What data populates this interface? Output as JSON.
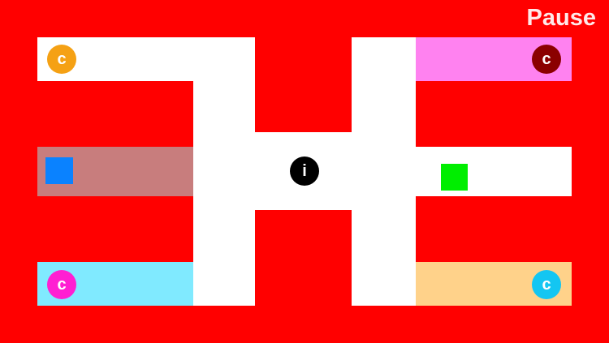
{
  "hud": {
    "pause_label": "Pause"
  },
  "colors": {
    "background": "#ff0000",
    "path": "#ffffff",
    "pink_zone": "#ff82f0",
    "gray_zone": "#c87d7d",
    "cyan_zone": "#80eaff",
    "orange_zone": "#ffd28a",
    "player": "#0a82ff",
    "goal": "#00ee00"
  },
  "coins": [
    {
      "name": "coin-top-left",
      "label": "c",
      "color": "#f5a114"
    },
    {
      "name": "coin-top-right",
      "label": "c",
      "color": "#8b0000"
    },
    {
      "name": "coin-bottom-left",
      "label": "c",
      "color": "#ff1fd2"
    },
    {
      "name": "coin-bottom-right",
      "label": "c",
      "color": "#13c6f2"
    }
  ],
  "info": {
    "label": "i",
    "color": "#000000"
  }
}
